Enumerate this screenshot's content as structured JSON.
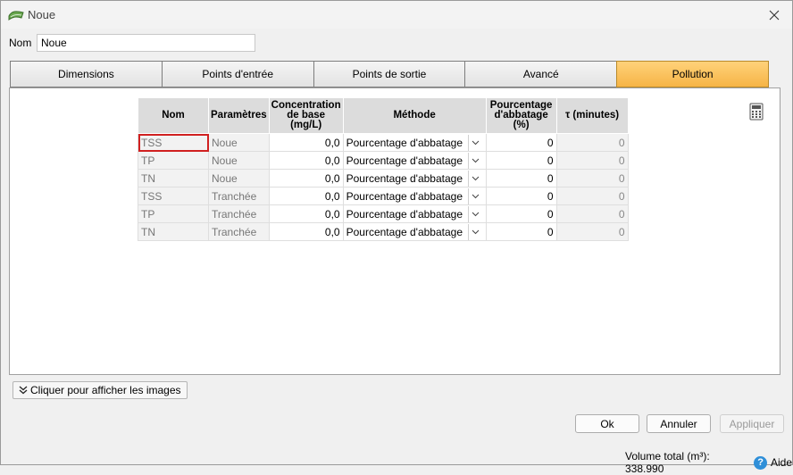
{
  "window": {
    "title": "Noue"
  },
  "name_field": {
    "label": "Nom",
    "value": "Noue"
  },
  "tabs": [
    {
      "label": "Dimensions",
      "active": false
    },
    {
      "label": "Points d'entrée",
      "active": false
    },
    {
      "label": "Points de sortie",
      "active": false
    },
    {
      "label": "Avancé",
      "active": false
    },
    {
      "label": "Pollution",
      "active": true
    }
  ],
  "table": {
    "headers": {
      "nom": "Nom",
      "parametres": "Paramètres",
      "concentration": "Concentration de base (mg/L)",
      "methode": "Méthode",
      "pourcentage": "Pourcentage d'abbatage (%)",
      "tau": "τ (minutes)"
    },
    "rows": [
      {
        "nom": "TSS",
        "parametres": "Noue",
        "concentration": "0,0",
        "methode": "Pourcentage d'abbatage",
        "pourcentage": "0",
        "tau": "0"
      },
      {
        "nom": "TP",
        "parametres": "Noue",
        "concentration": "0,0",
        "methode": "Pourcentage d'abbatage",
        "pourcentage": "0",
        "tau": "0"
      },
      {
        "nom": "TN",
        "parametres": "Noue",
        "concentration": "0,0",
        "methode": "Pourcentage d'abbatage",
        "pourcentage": "0",
        "tau": "0"
      },
      {
        "nom": "TSS",
        "parametres": "Tranchée",
        "concentration": "0,0",
        "methode": "Pourcentage d'abbatage",
        "pourcentage": "0",
        "tau": "0"
      },
      {
        "nom": "TP",
        "parametres": "Tranchée",
        "concentration": "0,0",
        "methode": "Pourcentage d'abbatage",
        "pourcentage": "0",
        "tau": "0"
      },
      {
        "nom": "TN",
        "parametres": "Tranchée",
        "concentration": "0,0",
        "methode": "Pourcentage d'abbatage",
        "pourcentage": "0",
        "tau": "0"
      }
    ]
  },
  "images_button": {
    "label": "Cliquer pour afficher les images"
  },
  "buttons": {
    "ok": "Ok",
    "annuler": "Annuler",
    "appliquer": "Appliquer"
  },
  "status": {
    "volume_label": "Volume total  (m³): 338.990",
    "help_label": "Aide"
  },
  "colors": {
    "active_tab": "#f6b446",
    "selected_cell_border": "#d02020",
    "help_icon": "#2f8fd8"
  }
}
